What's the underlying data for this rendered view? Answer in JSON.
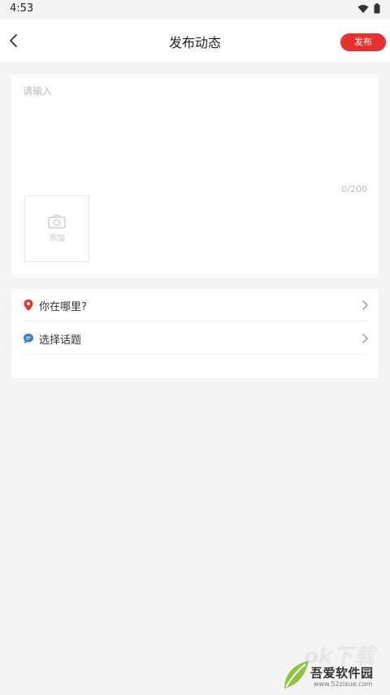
{
  "status_bar": {
    "time": "4:53",
    "icons": [
      "wifi-icon",
      "battery-icon"
    ]
  },
  "header": {
    "back_icon": "chevron-left-icon",
    "title": "发布动态",
    "publish_label": "发布",
    "accent_color": "#e8302c"
  },
  "editor": {
    "placeholder": "请输入",
    "counter": "0/200",
    "add_photo_icon": "camera-icon",
    "add_photo_label": "添加"
  },
  "options": [
    {
      "icon": "location-pin-icon",
      "icon_color": "#e8302c",
      "label": "你在哪里?"
    },
    {
      "icon": "topic-bubble-icon",
      "icon_color": "#2f7de1",
      "label": "选择话题"
    }
  ],
  "watermark": {
    "brand": "吾爱软件园",
    "url": "www.52zixue.com",
    "overlay": "ok下载"
  }
}
